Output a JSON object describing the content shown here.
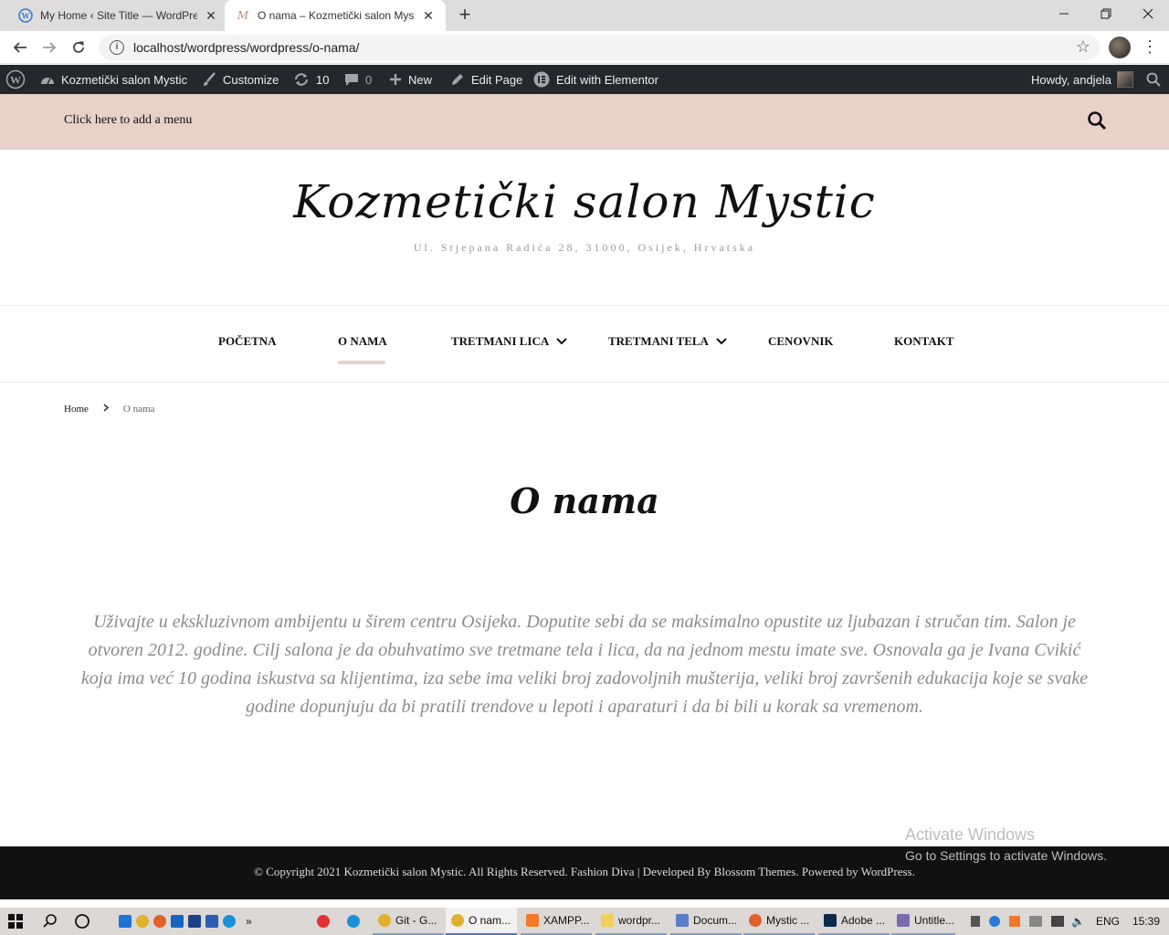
{
  "browser": {
    "tabs": [
      {
        "title": "My Home ‹ Site Title — WordPress",
        "active": false
      },
      {
        "title": "O nama – Kozmetički salon Mystic",
        "active": true
      }
    ],
    "url": "localhost/wordpress/wordpress/o-nama/"
  },
  "adminbar": {
    "site_name": "Kozmetički salon Mystic",
    "customize": "Customize",
    "updates_count": "10",
    "comments_count": "0",
    "new_label": "New",
    "edit_page": "Edit Page",
    "elementor": "Edit with Elementor",
    "howdy": "Howdy, andjela"
  },
  "header": {
    "add_menu": "Click here to add a menu",
    "site_title": "Kozmetički salon Mystic",
    "site_description": "Ul. Stjepana Radića 28, 31000, Osijek, Hrvatska"
  },
  "nav": {
    "items": [
      {
        "label": "POČETNA"
      },
      {
        "label": "O NAMA",
        "current": true
      },
      {
        "label": "TRETMANI LICA",
        "dropdown": true
      },
      {
        "label": "TRETMANI TELA",
        "dropdown": true
      },
      {
        "label": "CENOVNIK"
      },
      {
        "label": "KONTAKT"
      }
    ]
  },
  "breadcrumb": {
    "home": "Home",
    "current": "O nama"
  },
  "page": {
    "title": "O nama",
    "body": "Uživajte u ekskluzivnom ambijentu u širem centru Osijeka. Doputite sebi da se maksimalno opustite uz ljubazan i stručan tim. Salon je otvoren 2012. godine. Cilj salona je da obuhvatimo sve tretmane tela i lica, da na jednom mestu imate sve. Osnovala ga je Ivana Cvikić koja ima već 10 godina iskustva sa klijentima, iza sebe ima veliki broj zadovoljnih mušterija, veliki broj završenih edukacija koje se svake godine dopunjuju da bi pratili trendove u lepoti i aparaturi i da bi bili u korak sa vremenom."
  },
  "watermark": {
    "line1": "Activate Windows",
    "line2": "Go to Settings to activate Windows."
  },
  "footer": {
    "copyright": "© Copyright 2021 Kozmetički salon Mystic. All Rights Reserved. Fashion Diva | Developed By Blossom Themes. Powered by WordPress."
  },
  "taskbar": {
    "items": [
      "Git - G...",
      "O nam...",
      "XAMPP...",
      "wordpr...",
      "Docum...",
      "Mystic ...",
      "Adobe ...",
      "Untitle..."
    ],
    "lang": "ENG",
    "time": "15:39"
  },
  "colors": {
    "accent_pink": "#e9d0c9",
    "adminbar": "#23282d",
    "footer": "#111111"
  }
}
